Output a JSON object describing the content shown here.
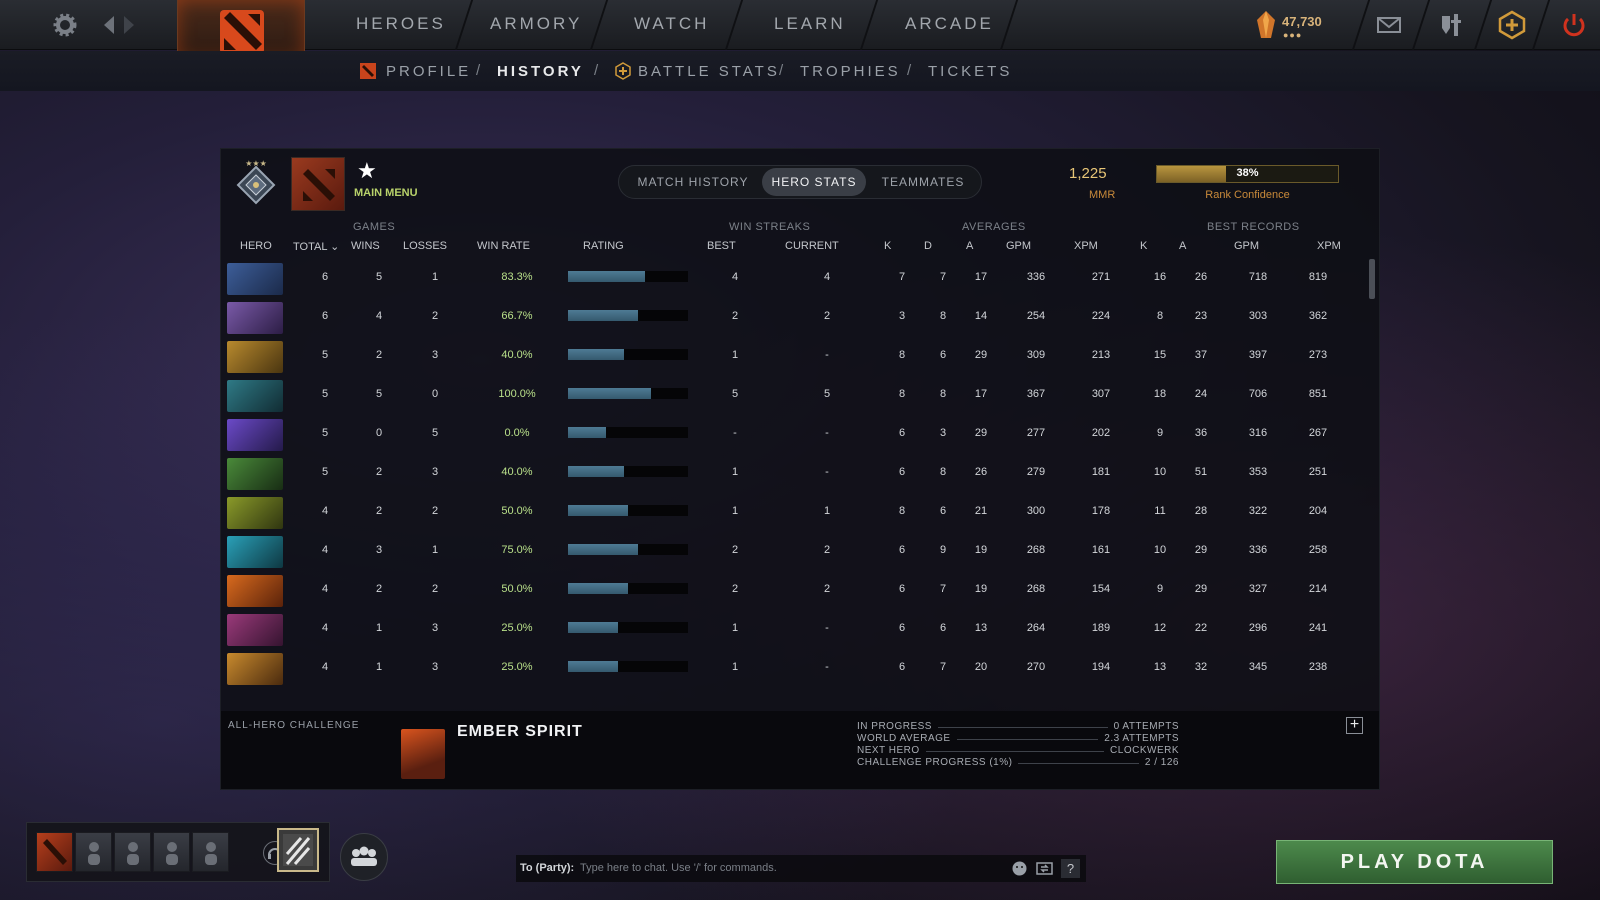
{
  "nav": {
    "items": [
      "HEROES",
      "ARMORY",
      "WATCH",
      "LEARN",
      "ARCADE"
    ],
    "currency": "47,730",
    "currency_dots": "●●●",
    "icons": [
      "settings-gear",
      "back-forward",
      "mail",
      "inventory",
      "plus-compendium",
      "power"
    ]
  },
  "subnav": {
    "items": [
      "PROFILE",
      "HISTORY",
      "BATTLE STATS",
      "TROPHIES",
      "TICKETS"
    ],
    "active": "HISTORY",
    "slash": "/"
  },
  "profile": {
    "main_menu": "MAIN MENU",
    "star": "★",
    "mmr_value": "1,225",
    "mmr_label": "MMR",
    "confidence_pct": "38%",
    "confidence_value": 0.38,
    "confidence_label": "Rank Confidence"
  },
  "tabs": [
    "MATCH HISTORY",
    "HERO STATS",
    "TEAMMATES"
  ],
  "active_tab": "HERO STATS",
  "table": {
    "groups": {
      "games": "GAMES",
      "win_streaks": "WIN STREAKS",
      "averages": "AVERAGES",
      "best_records": "BEST RECORDS"
    },
    "columns": [
      "HERO",
      "TOTAL ⌄",
      "WINS",
      "LOSSES",
      "WIN RATE",
      "RATING",
      "BEST",
      "CURRENT",
      "K",
      "D",
      "A",
      "GPM",
      "XPM",
      "K",
      "A",
      "GPM",
      "XPM"
    ],
    "rows": [
      {
        "hero": "hero-blue",
        "total": "6",
        "wins": "5",
        "losses": "1",
        "win_rate": "83.3%",
        "rating": 0.64,
        "best": "4",
        "current": "4",
        "k": "7",
        "d": "7",
        "a": "17",
        "gpm": "336",
        "xpm": "271",
        "bk": "16",
        "ba": "26",
        "bgpm": "718",
        "bxpm": "819"
      },
      {
        "hero": "hero-purple",
        "total": "6",
        "wins": "4",
        "losses": "2",
        "win_rate": "66.7%",
        "rating": 0.58,
        "best": "2",
        "current": "2",
        "k": "3",
        "d": "8",
        "a": "14",
        "gpm": "254",
        "xpm": "224",
        "bk": "8",
        "ba": "23",
        "bgpm": "303",
        "bxpm": "362"
      },
      {
        "hero": "hero-gold",
        "total": "5",
        "wins": "2",
        "losses": "3",
        "win_rate": "40.0%",
        "rating": 0.47,
        "best": "1",
        "current": "-",
        "k": "8",
        "d": "6",
        "a": "29",
        "gpm": "309",
        "xpm": "213",
        "bk": "15",
        "ba": "37",
        "bgpm": "397",
        "bxpm": "273"
      },
      {
        "hero": "hero-teal",
        "total": "5",
        "wins": "5",
        "losses": "0",
        "win_rate": "100.0%",
        "rating": 0.69,
        "best": "5",
        "current": "5",
        "k": "8",
        "d": "8",
        "a": "17",
        "gpm": "367",
        "xpm": "307",
        "bk": "18",
        "ba": "24",
        "bgpm": "706",
        "bxpm": "851"
      },
      {
        "hero": "hero-violet",
        "total": "5",
        "wins": "0",
        "losses": "5",
        "win_rate": "0.0%",
        "rating": 0.32,
        "best": "-",
        "current": "-",
        "k": "6",
        "d": "3",
        "a": "29",
        "gpm": "277",
        "xpm": "202",
        "bk": "9",
        "ba": "36",
        "bgpm": "316",
        "bxpm": "267"
      },
      {
        "hero": "hero-green",
        "total": "5",
        "wins": "2",
        "losses": "3",
        "win_rate": "40.0%",
        "rating": 0.47,
        "best": "1",
        "current": "-",
        "k": "6",
        "d": "8",
        "a": "26",
        "gpm": "279",
        "xpm": "181",
        "bk": "10",
        "ba": "51",
        "bgpm": "353",
        "bxpm": "251"
      },
      {
        "hero": "hero-olive",
        "total": "4",
        "wins": "2",
        "losses": "2",
        "win_rate": "50.0%",
        "rating": 0.5,
        "best": "1",
        "current": "1",
        "k": "8",
        "d": "6",
        "a": "21",
        "gpm": "300",
        "xpm": "178",
        "bk": "11",
        "ba": "28",
        "bgpm": "322",
        "bxpm": "204"
      },
      {
        "hero": "hero-cyan",
        "total": "4",
        "wins": "3",
        "losses": "1",
        "win_rate": "75.0%",
        "rating": 0.58,
        "best": "2",
        "current": "2",
        "k": "6",
        "d": "9",
        "a": "19",
        "gpm": "268",
        "xpm": "161",
        "bk": "10",
        "ba": "29",
        "bgpm": "336",
        "bxpm": "258"
      },
      {
        "hero": "hero-orange",
        "total": "4",
        "wins": "2",
        "losses": "2",
        "win_rate": "50.0%",
        "rating": 0.5,
        "best": "2",
        "current": "2",
        "k": "6",
        "d": "7",
        "a": "19",
        "gpm": "268",
        "xpm": "154",
        "bk": "9",
        "ba": "29",
        "bgpm": "327",
        "bxpm": "214"
      },
      {
        "hero": "hero-magenta",
        "total": "4",
        "wins": "1",
        "losses": "3",
        "win_rate": "25.0%",
        "rating": 0.42,
        "best": "1",
        "current": "-",
        "k": "6",
        "d": "6",
        "a": "13",
        "gpm": "264",
        "xpm": "189",
        "bk": "12",
        "ba": "22",
        "bgpm": "296",
        "bxpm": "241"
      },
      {
        "hero": "hero-amber",
        "total": "4",
        "wins": "1",
        "losses": "3",
        "win_rate": "25.0%",
        "rating": 0.42,
        "best": "1",
        "current": "-",
        "k": "6",
        "d": "7",
        "a": "20",
        "gpm": "270",
        "xpm": "194",
        "bk": "13",
        "ba": "32",
        "bgpm": "345",
        "bxpm": "238"
      }
    ]
  },
  "challenge": {
    "title": "ALL-HERO CHALLENGE",
    "hero_name": "EMBER SPIRIT",
    "stats": [
      {
        "label": "IN PROGRESS",
        "value": "0 ATTEMPTS"
      },
      {
        "label": "WORLD AVERAGE",
        "value": "2.3 ATTEMPTS"
      },
      {
        "label": "NEXT HERO",
        "value": "CLOCKWERK"
      },
      {
        "label": "CHALLENGE PROGRESS (1%)",
        "value": "2 / 126"
      }
    ],
    "plus": "+"
  },
  "chat": {
    "to": "To (Party):",
    "placeholder": "Type here to chat. Use '/' for commands.",
    "help": "?"
  },
  "play_button": "PLAY DOTA"
}
